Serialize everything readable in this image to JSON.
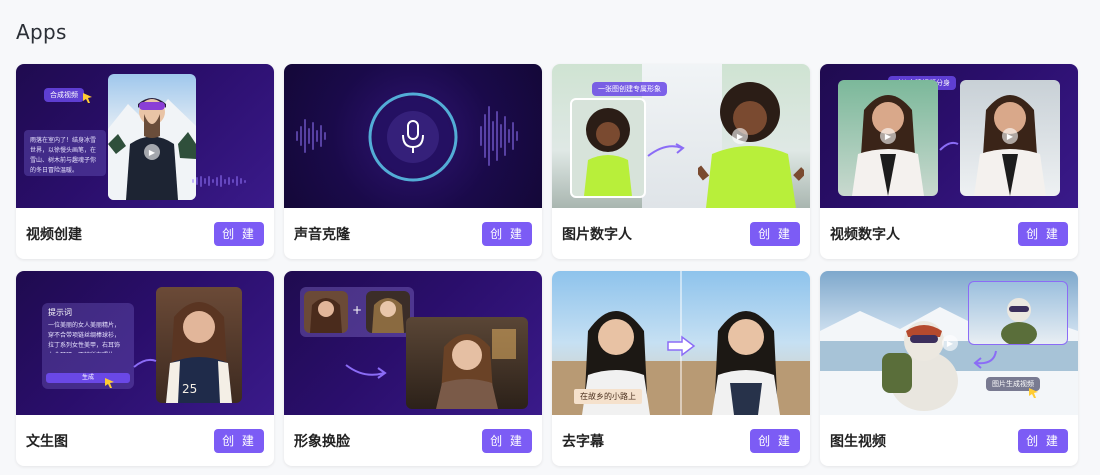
{
  "page": {
    "title": "Apps"
  },
  "apps": [
    {
      "title": "视频创建",
      "button": "创 建",
      "tag": "合成视频",
      "note": "雨落在室内了！结身冰雪世界，以徐慢头画笔，在雪山、树木前与趣魂子你的冬日冒险温暖。"
    },
    {
      "title": "声音克隆",
      "button": "创 建"
    },
    {
      "title": "图片数字人",
      "button": "创 建",
      "tag": "一张图创建专属形象"
    },
    {
      "title": "视频数字人",
      "button": "创 建",
      "tag": "对炒克隆视频分身"
    },
    {
      "title": "文生图",
      "button": "创 建",
      "panel_title": "提示词",
      "note": "一位美丽的女人美丽精片，穿不合带项链丝绸棒球衫，拉丁系列女性美甲，右耳饰上金耳环，不被所有照片景，面部的主色合洛。",
      "panel_button": "生成"
    },
    {
      "title": "形象换脸",
      "button": "创 建"
    },
    {
      "title": "去字幕",
      "button": "创 建",
      "caption": "在故乡的小路上"
    },
    {
      "title": "图生视频",
      "button": "创 建",
      "tag": "图片生成视频"
    }
  ],
  "colors": {
    "accent": "#7c5cf5",
    "thumb_dark": "#2a0e6b"
  }
}
